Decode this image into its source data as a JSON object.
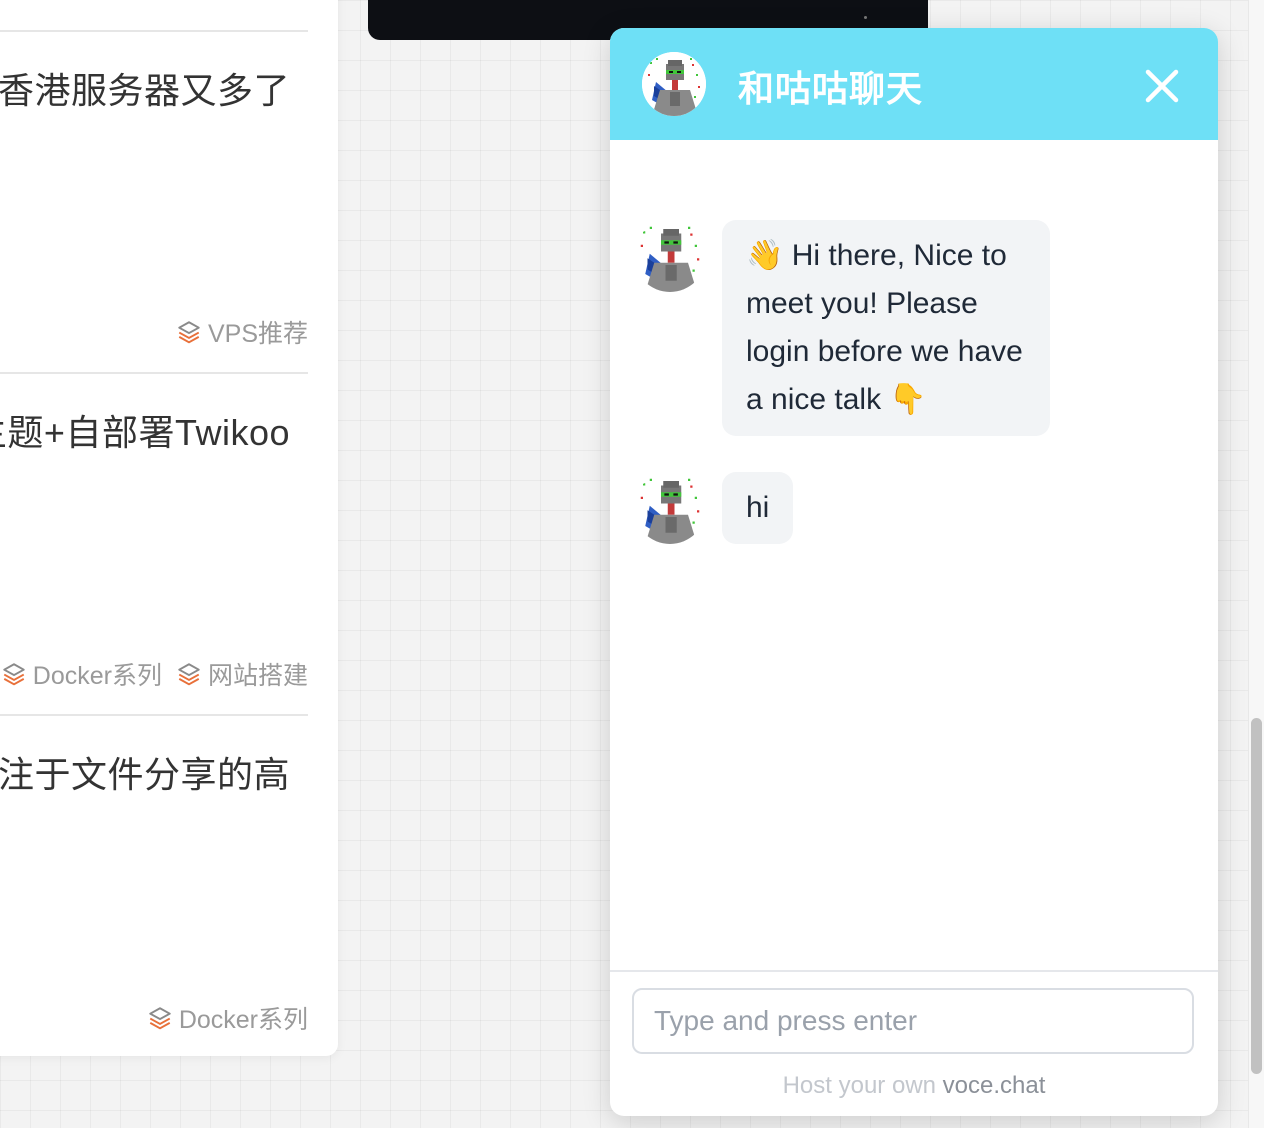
{
  "posts": [
    {
      "title": "香港服务器又多了",
      "tags": [
        {
          "label": "VPS推荐"
        }
      ]
    },
    {
      "title": "主题+自部署Twikoo",
      "tags": [
        {
          "label": "Docker系列"
        },
        {
          "label": "网站搭建"
        }
      ]
    },
    {
      "title": "注于文件分享的高",
      "tags": [
        {
          "label": "Docker系列"
        }
      ]
    }
  ],
  "chat": {
    "title": "和咕咕聊天",
    "messages": [
      {
        "text": "👋 Hi there, Nice to meet you! Please login before we have a nice talk 👇"
      },
      {
        "text": "hi"
      }
    ],
    "input": {
      "placeholder": "Type and press enter",
      "value": ""
    },
    "footer": {
      "prefix": "Host your own",
      "link": "voce.chat"
    }
  },
  "colors": {
    "header": "#6ee0f6",
    "bubble": "#f2f4f6",
    "tag_icon_top": "#8a8a8a",
    "tag_icon_bottom": "#e8703a"
  },
  "icons": {
    "tag": "layers-icon",
    "close": "close-icon",
    "avatar": "pixel-avatar"
  }
}
